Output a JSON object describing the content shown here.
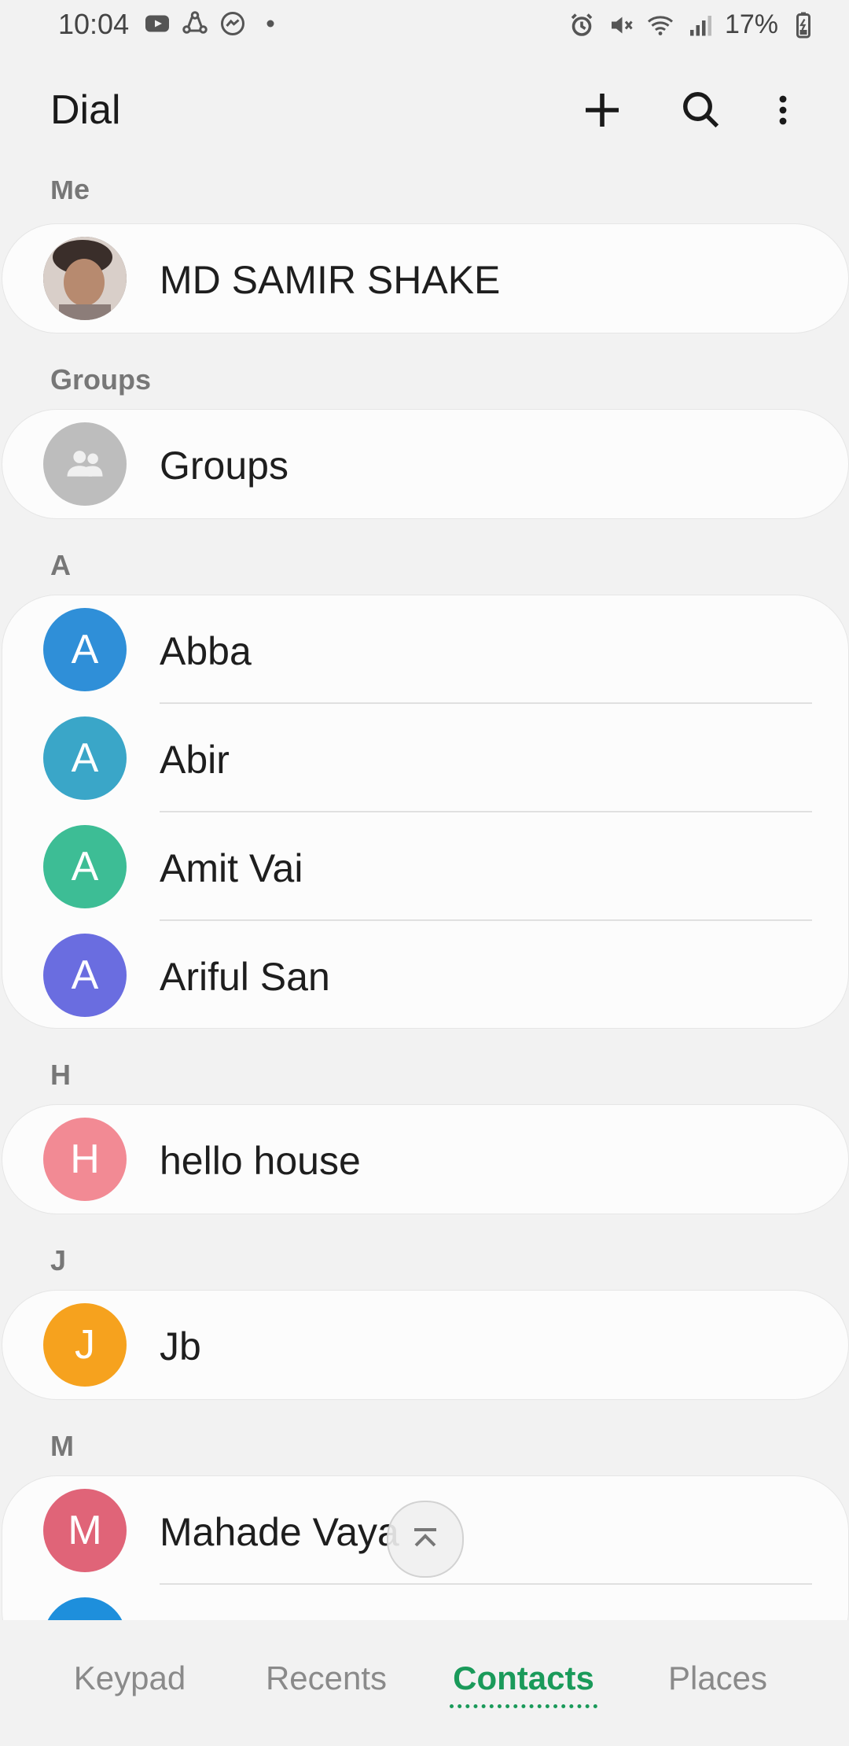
{
  "status_bar": {
    "time": "10:04",
    "battery": "17%"
  },
  "header": {
    "title": "Dial"
  },
  "sections": {
    "me": {
      "label": "Me",
      "name": "MD SAMIR SHAKE"
    },
    "groups": {
      "label": "Groups",
      "name": "Groups"
    },
    "a": {
      "label": "A",
      "contacts": [
        {
          "name": "Abba",
          "initial": "A"
        },
        {
          "name": "Abir",
          "initial": "A"
        },
        {
          "name": "Amit Vai",
          "initial": "A"
        },
        {
          "name": "Ariful San",
          "initial": "A"
        }
      ]
    },
    "h": {
      "label": "H",
      "contacts": [
        {
          "name": "hello house",
          "initial": "H"
        }
      ]
    },
    "j": {
      "label": "J",
      "contacts": [
        {
          "name": "Jb",
          "initial": "J"
        }
      ]
    },
    "m": {
      "label": "M",
      "contacts": [
        {
          "name": "Mahade Vaya",
          "initial": "M"
        }
      ]
    }
  },
  "tabs": [
    "Keypad",
    "Recents",
    "Contacts",
    "Places"
  ],
  "colors": {
    "abba": "#2f8fd8",
    "abir": "#3aa6c8",
    "amit": "#3dbd95",
    "ariful": "#6a6de0",
    "hello": "#f28a94",
    "jb": "#f6a21e",
    "mahade": "#e06478",
    "accent": "#1a9a5a"
  }
}
